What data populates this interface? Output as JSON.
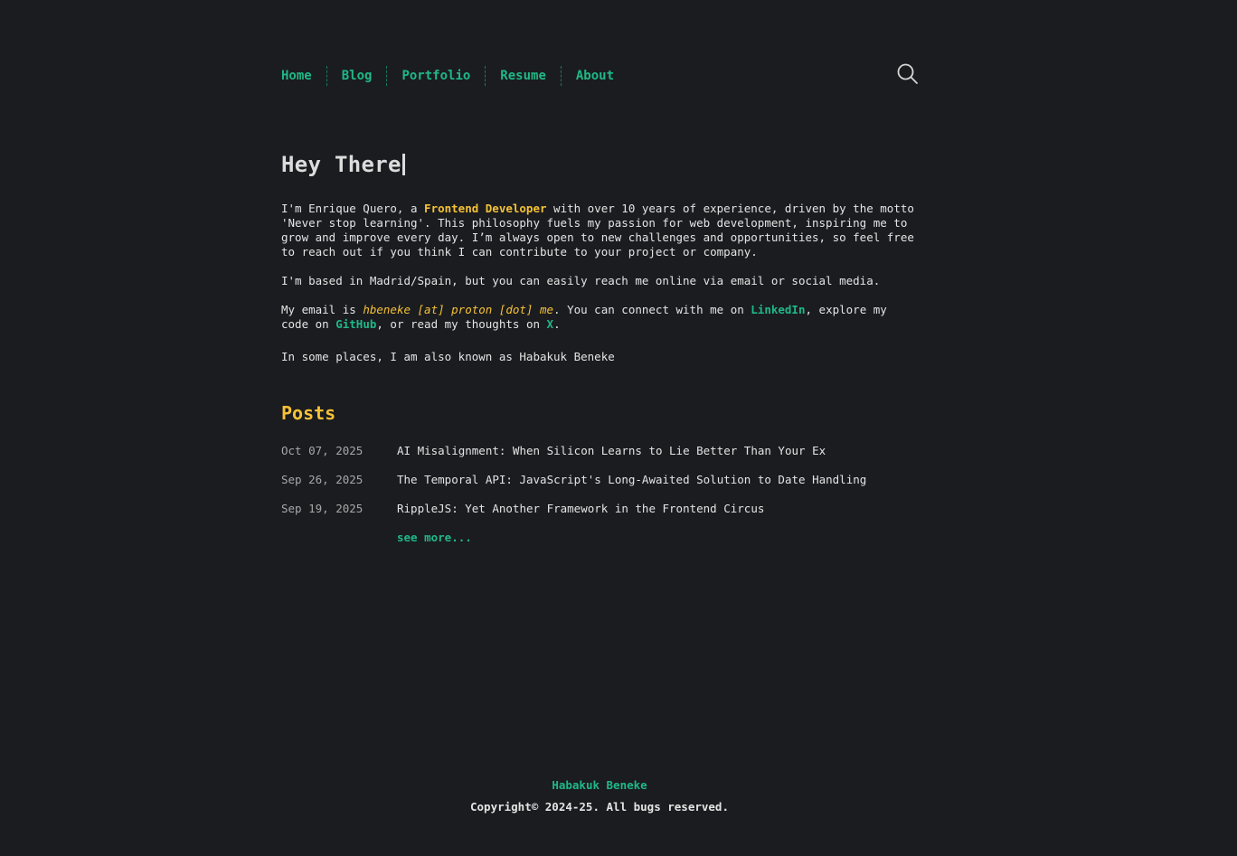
{
  "nav": {
    "items": [
      {
        "label": "Home"
      },
      {
        "label": "Blog"
      },
      {
        "label": "Portfolio"
      },
      {
        "label": "Resume"
      },
      {
        "label": "About"
      }
    ],
    "search_icon": "search-icon"
  },
  "hero": {
    "title": "Hey There",
    "intro": {
      "prefix": "I'm Enrique Quero, a ",
      "role": "Frontend Developer",
      "suffix": " with over 10 years of experience, driven by the motto 'Never stop learning'. This philosophy fuels my passion for web development, inspiring me to grow and improve every day. I’m always open to new challenges and opportunities, so feel free to reach out if you think I can contribute to your project or company."
    },
    "location": "I'm based in Madrid/Spain, but you can easily reach me online via email or social media.",
    "contact": {
      "prefix": "My email is ",
      "email": "hbeneke [at] proton [dot] me",
      "mid1": ". You can connect with me on ",
      "linkedin": "LinkedIn",
      "mid2": ", explore my code on ",
      "github": "GitHub",
      "mid3": ", or read my thoughts on ",
      "x": "X",
      "end": "."
    },
    "aka": "In some places, I am also known as Habakuk Beneke"
  },
  "posts": {
    "title": "Posts",
    "items": [
      {
        "date": "Oct 07, 2025",
        "title": "AI Misalignment: When Silicon Learns to Lie Better Than Your Ex"
      },
      {
        "date": "Sep 26, 2025",
        "title": "The Temporal API: JavaScript's Long-Awaited Solution to Date Handling"
      },
      {
        "date": "Sep 19, 2025",
        "title": "RippleJS: Yet Another Framework in the Frontend Circus"
      }
    ],
    "see_more": "see more..."
  },
  "footer": {
    "name": "Habakuk Beneke",
    "copyright": "Copyright© 2024-25. All bugs reserved."
  },
  "colors": {
    "background": "#1b1c20",
    "accent_green": "#1fb886",
    "accent_yellow": "#f5c236",
    "text": "#e4e4e4"
  }
}
